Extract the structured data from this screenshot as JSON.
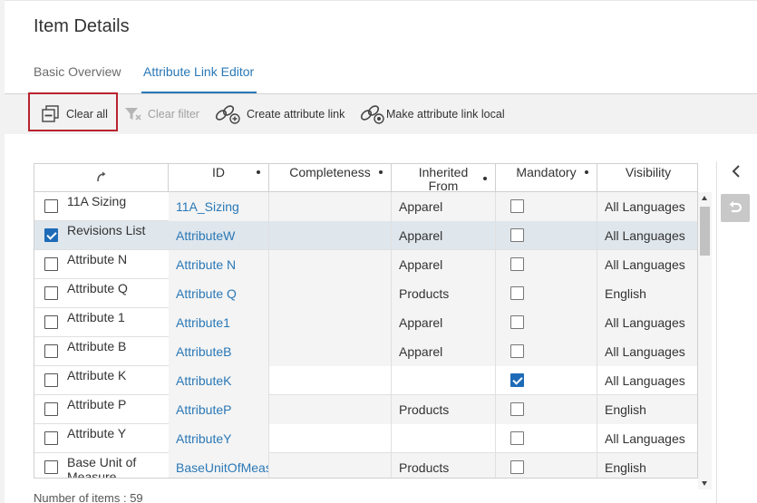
{
  "page": {
    "title": "Item Details"
  },
  "tabs": [
    {
      "label": "Basic Overview",
      "active": false
    },
    {
      "label": "Attribute Link Editor",
      "active": true
    }
  ],
  "toolbar": {
    "clear_all": "Clear all",
    "clear_filter": "Clear filter",
    "create_link": "Create attribute link",
    "make_local": "Make attribute link local"
  },
  "columns": {
    "id": "ID",
    "completeness": "Completeness",
    "inherited_from": "Inherited From",
    "mandatory": "Mandatory",
    "visibility": "Visibility"
  },
  "rows": [
    {
      "checked": false,
      "name": "11A Sizing",
      "id": "11A_Sizing",
      "completeness": "",
      "inherited": "Apparel",
      "mandatory": false,
      "visibility": "All Languages",
      "selected": false
    },
    {
      "checked": true,
      "name": "Revisions List",
      "id": "AttributeW",
      "completeness": "",
      "inherited": "Apparel",
      "mandatory": false,
      "visibility": "All Languages",
      "selected": true
    },
    {
      "checked": false,
      "name": "Attribute N",
      "id": "Attribute N",
      "completeness": "",
      "inherited": "Apparel",
      "mandatory": false,
      "visibility": "All Languages",
      "selected": false
    },
    {
      "checked": false,
      "name": "Attribute Q",
      "id": "Attribute Q",
      "completeness": "",
      "inherited": "Products",
      "mandatory": false,
      "visibility": "English",
      "selected": false
    },
    {
      "checked": false,
      "name": "Attribute 1",
      "id": "Attribute1",
      "completeness": "",
      "inherited": "Apparel",
      "mandatory": false,
      "visibility": "All Languages",
      "selected": false
    },
    {
      "checked": false,
      "name": "Attribute B",
      "id": "AttributeB",
      "completeness": "",
      "inherited": "Apparel",
      "mandatory": false,
      "visibility": "All Languages",
      "selected": false
    },
    {
      "checked": false,
      "name": "Attribute K",
      "id": "AttributeK",
      "completeness": "",
      "inherited": "",
      "mandatory": true,
      "visibility": "All Languages",
      "selected": false
    },
    {
      "checked": false,
      "name": "Attribute P",
      "id": "AttributeP",
      "completeness": "",
      "inherited": "Products",
      "mandatory": false,
      "visibility": "English",
      "selected": false
    },
    {
      "checked": false,
      "name": "Attribute Y",
      "id": "AttributeY",
      "completeness": "",
      "inherited": "",
      "mandatory": false,
      "visibility": "All Languages",
      "selected": false
    },
    {
      "checked": false,
      "name": "Base Unit of Measure",
      "id": "BaseUnitOfMeasure",
      "completeness": "",
      "inherited": "Products",
      "mandatory": false,
      "visibility": "English",
      "selected": false
    }
  ],
  "footer": {
    "count_text": "Number of items : 59"
  },
  "colors": {
    "accent": "#2a78b6",
    "highlight_border": "#b8232f",
    "checkbox_on": "#1e6bb8"
  },
  "icons": [
    "clear-all-icon",
    "clear-filter-icon",
    "create-link-icon",
    "make-local-icon",
    "swap-icon",
    "collapse-chevron-icon",
    "undo-icon"
  ]
}
